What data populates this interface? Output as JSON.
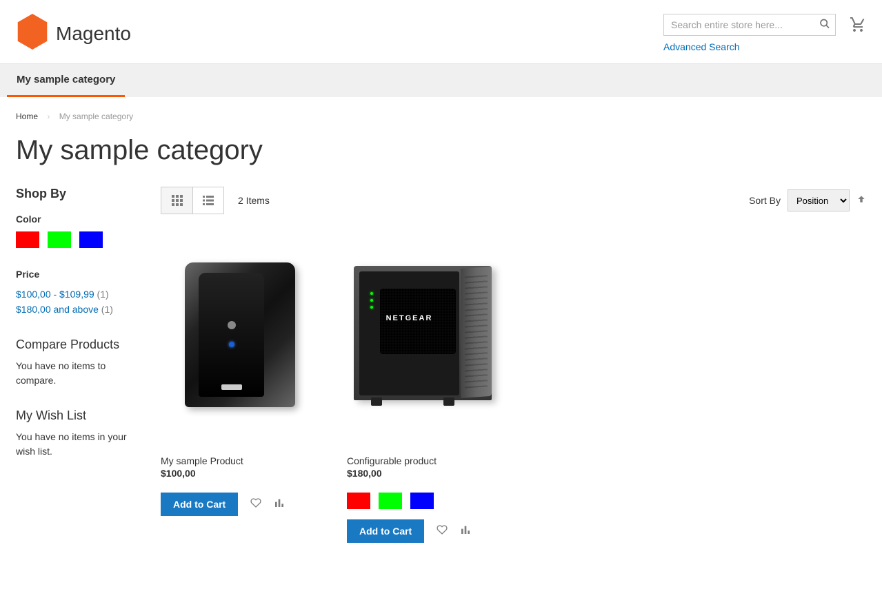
{
  "header": {
    "logoText": "Magento",
    "searchPlaceholder": "Search entire store here...",
    "advancedSearch": "Advanced Search"
  },
  "nav": {
    "item": "My sample category"
  },
  "breadcrumb": {
    "home": "Home",
    "current": "My sample category"
  },
  "pageTitle": "My sample category",
  "sidebar": {
    "shopBy": "Shop By",
    "colorLabel": "Color",
    "colors": [
      "#ff0000",
      "#00ff00",
      "#0000ff"
    ],
    "priceLabel": "Price",
    "priceRanges": [
      {
        "label": "$100,00 - $109,99",
        "count": "(1)"
      },
      {
        "label": "$180,00 and above",
        "count": "(1)"
      }
    ],
    "compareTitle": "Compare Products",
    "compareEmpty": "You have no items to compare.",
    "wishlistTitle": "My Wish List",
    "wishlistEmpty": "You have no items in your wish list."
  },
  "toolbar": {
    "itemCount": "2 Items",
    "sortLabel": "Sort By",
    "sortOptions": [
      "Position"
    ],
    "sortSelected": "Position"
  },
  "products": [
    {
      "name": "My sample Product",
      "price": "$100,00",
      "addToCart": "Add to Cart",
      "swatches": null
    },
    {
      "name": "Configurable product",
      "price": "$180,00",
      "addToCart": "Add to Cart",
      "swatches": [
        "#ff0000",
        "#00ff00",
        "#0000ff"
      ]
    }
  ]
}
